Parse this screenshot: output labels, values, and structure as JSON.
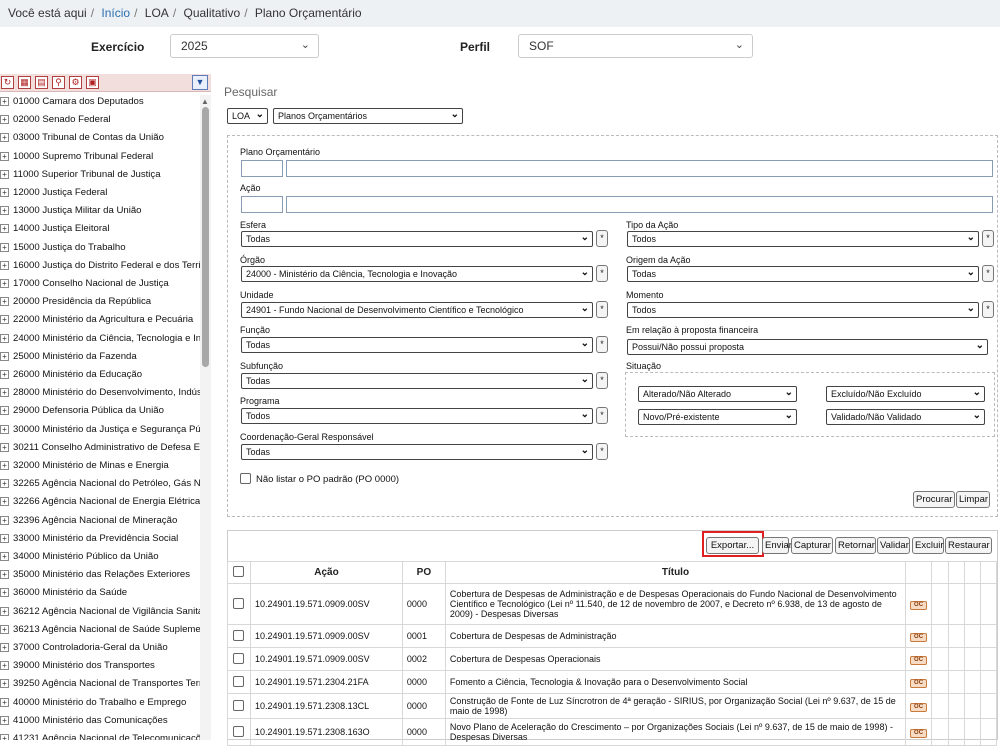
{
  "breadcrumb": {
    "prefix": "Você está aqui",
    "items": [
      "Início",
      "LOA",
      "Qualitativo",
      "Plano Orçamentário"
    ]
  },
  "header": {
    "exercicio_label": "Exercício",
    "exercicio_value": "2025",
    "perfil_label": "Perfil",
    "perfil_value": "SOF"
  },
  "tree": {
    "items": [
      "01000 Camara dos Deputados",
      "02000 Senado Federal",
      "03000 Tribunal de Contas da União",
      "10000 Supremo Tribunal Federal",
      "11000 Superior Tribunal de Justiça",
      "12000 Justiça Federal",
      "13000 Justiça Militar da União",
      "14000 Justiça Eleitoral",
      "15000 Justiça do Trabalho",
      "16000 Justiça do Distrito Federal e dos Territó",
      "17000 Conselho Nacional de Justiça",
      "20000 Presidência da República",
      "22000 Ministério da Agricultura e Pecuária",
      "24000 Ministério da Ciência, Tecnologia e Inov",
      "25000 Ministério da Fazenda",
      "26000 Ministério da Educação",
      "28000 Ministério do Desenvolvimento, Indústri",
      "29000 Defensoria Pública da União",
      "30000 Ministério da Justiça e Segurança Públi",
      "30211 Conselho Administrativo de Defesa Eco",
      "32000 Ministério de Minas e Energia",
      "32265 Agência Nacional do Petróleo, Gás Nat",
      "32266 Agência Nacional de Energia Elétrica",
      "32396 Agência Nacional de Mineração",
      "33000 Ministério da Previdência Social",
      "34000 Ministério Público da União",
      "35000 Ministério das Relações Exteriores",
      "36000 Ministério da Saúde",
      "36212 Agência Nacional de Vigilância Sanitári",
      "36213 Agência Nacional de Saúde Suplement",
      "37000 Controladoria-Geral da União",
      "39000 Ministério dos Transportes",
      "39250 Agência Nacional de Transportes Terres",
      "40000 Ministério do Trabalho e Emprego",
      "41000 Ministério das Comunicações",
      "41231 Agência Nacional de Telecomunicações"
    ]
  },
  "search": {
    "title": "Pesquisar",
    "scope_value": "LOA",
    "type_value": "Planos Orçamentários",
    "plano_label": "Plano Orçamentário",
    "acao_label": "Ação",
    "esfera_label": "Esfera",
    "esfera_value": "Todas",
    "tipo_acao_label": "Tipo da Ação",
    "tipo_acao_value": "Todos",
    "orgao_label": "Órgão",
    "orgao_value": "24000 - Ministério da Ciência, Tecnologia e Inovação",
    "origem_label": "Origem da Ação",
    "origem_value": "Todas",
    "unidade_label": "Unidade",
    "unidade_value": "24901 - Fundo Nacional de Desenvolvimento Científico e Tecnológico",
    "momento_label": "Momento",
    "momento_value": "Todos",
    "funcao_label": "Função",
    "funcao_value": "Todas",
    "proposta_label": "Em relação à proposta financeira",
    "proposta_value": "Possui/Não possui proposta",
    "subfuncao_label": "Subfunção",
    "subfuncao_value": "Todas",
    "situacao_label": "Situação",
    "sit_alterado": "Alterado/Não Alterado",
    "sit_excluido": "Excluído/Não Excluído",
    "sit_novo": "Novo/Pré-existente",
    "sit_validado": "Validado/Não Validado",
    "programa_label": "Programa",
    "programa_value": "Todos",
    "coord_label": "Coordenação-Geral Responsável",
    "coord_value": "Todas",
    "nao_listar_label": "Não listar o PO padrão (PO 0000)",
    "star": "*",
    "procurar": "Procurar",
    "limpar": "Limpar"
  },
  "actions": [
    "Exportar...",
    "Enviar",
    "Capturar",
    "Retornar",
    "Validar",
    "Excluir",
    "Restaurar"
  ],
  "table": {
    "headers": [
      "Ação",
      "PO",
      "Título"
    ],
    "badge": "OC",
    "rows": [
      {
        "acao": "10.24901.19.571.0909.00SV",
        "po": "0000",
        "titulo": "Cobertura de Despesas de Administração e de Despesas Operacionais do Fundo Nacional de Desenvolvimento Científico e Tecnológico (Lei nº 11.540, de 12 de novembro de 2007, e Decreto nº 6.938, de 13 de agosto de 2009) - Despesas Diversas"
      },
      {
        "acao": "10.24901.19.571.0909.00SV",
        "po": "0001",
        "titulo": "Cobertura de Despesas de Administração"
      },
      {
        "acao": "10.24901.19.571.0909.00SV",
        "po": "0002",
        "titulo": "Cobertura de Despesas Operacionais"
      },
      {
        "acao": "10.24901.19.571.2304.21FA",
        "po": "0000",
        "titulo": "Fomento a Ciência, Tecnologia & Inovação para o Desenvolvimento Social"
      },
      {
        "acao": "10.24901.19.571.2308.13CL",
        "po": "0000",
        "titulo": "Construção de Fonte de Luz Síncrotron de 4ª geração - SIRIUS, por Organização Social (Lei nº 9.637, de 15 de maio de 1998)"
      },
      {
        "acao": "10.24901.19.571.2308.163O",
        "po": "0000",
        "titulo": "Novo Plano de Aceleração do Crescimento – por Organizações Sociais (Lei nº 9.637, de 15 de maio de 1998) - Despesas Diversas"
      }
    ]
  }
}
